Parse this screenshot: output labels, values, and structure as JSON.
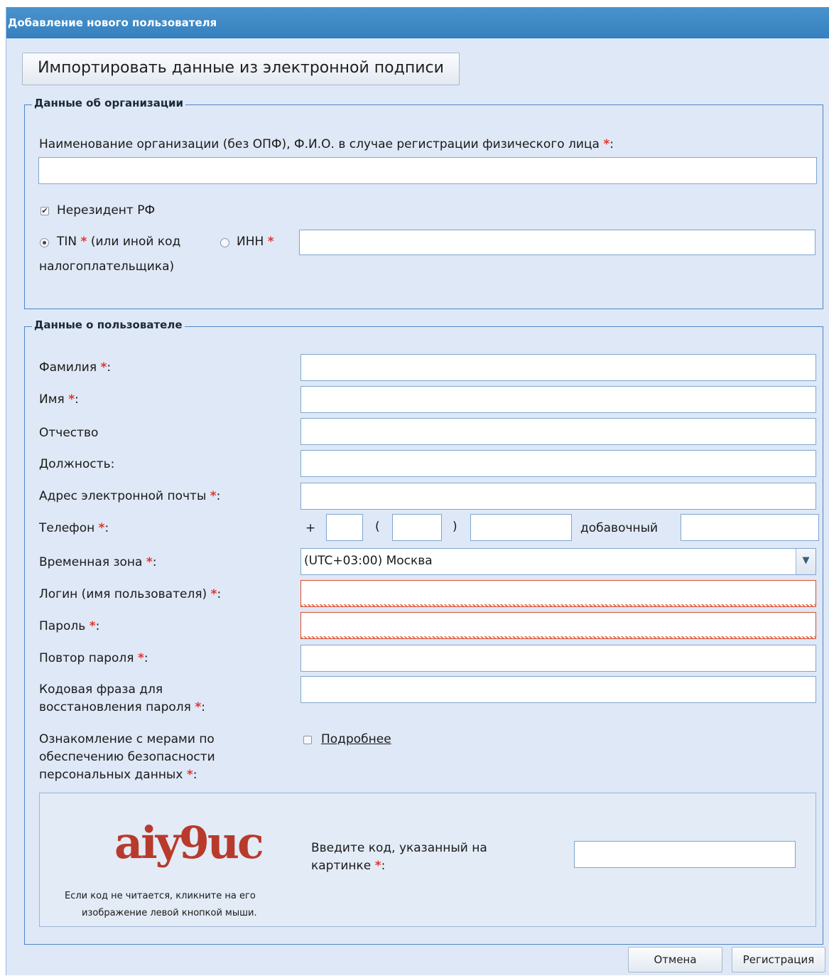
{
  "window": {
    "title": "Добавление нового пользователя"
  },
  "import_button": "Импортировать данные из электронной подписи",
  "org_section": {
    "legend": "Данные об организации",
    "name_label": "Наименование организации (без ОПФ), Ф.И.О. в случае регистрации физического лица",
    "name_value": "",
    "nonresident_label": "Нерезидент РФ",
    "nonresident_checked": true,
    "tin_label": "TIN",
    "tin_note_1": "(или иной код",
    "tin_note_2": "налогоплательщика)",
    "inn_label": "ИНН",
    "tax_code_value": ""
  },
  "user_section": {
    "legend": "Данные о пользователе",
    "fields": {
      "lastname": {
        "label": "Фамилия",
        "value": ""
      },
      "firstname": {
        "label": "Имя",
        "value": ""
      },
      "patronymic": {
        "label": "Отчество",
        "value": ""
      },
      "position": {
        "label": "Должность:",
        "value": ""
      },
      "email": {
        "label": "Адрес электронной почты",
        "value": ""
      },
      "phone": {
        "label": "Телефон",
        "plus": "+",
        "paren_open": "(",
        "paren_close": ")",
        "ext_label": "добавочный"
      },
      "timezone": {
        "label": "Временная зона",
        "value": "(UTC+03:00) Москва"
      },
      "login": {
        "label": "Логин (имя пользователя)",
        "value": ""
      },
      "password": {
        "label": "Пароль",
        "value": ""
      },
      "password_repeat": {
        "label": "Повтор пароля",
        "value": ""
      },
      "code_phrase": {
        "label_line1": "Кодовая фраза для",
        "label_line2": "восстановления пароля",
        "value": ""
      },
      "privacy": {
        "label_line1": "Ознакомление с мерами по",
        "label_line2": "обеспечению безопасности",
        "label_line3": "персональных данных",
        "checked": false,
        "link": "Подробнее"
      }
    },
    "captcha": {
      "image_text": "aiy9uc",
      "prompt_line1": "Введите код, указанный на",
      "prompt_line2": "картинке",
      "hint_line1": "Если код не читается, кликните на его",
      "hint_line2": "изображение левой кнопкой мыши.",
      "value": ""
    }
  },
  "required_mark": "*",
  "colon": ":",
  "buttons": {
    "cancel": "Отмена",
    "register": "Регистрация"
  },
  "colors": {
    "titlebar": "#3580bf",
    "panel": "#dfe8f6",
    "required": "#e5342b",
    "error_border": "#d94f2c"
  }
}
